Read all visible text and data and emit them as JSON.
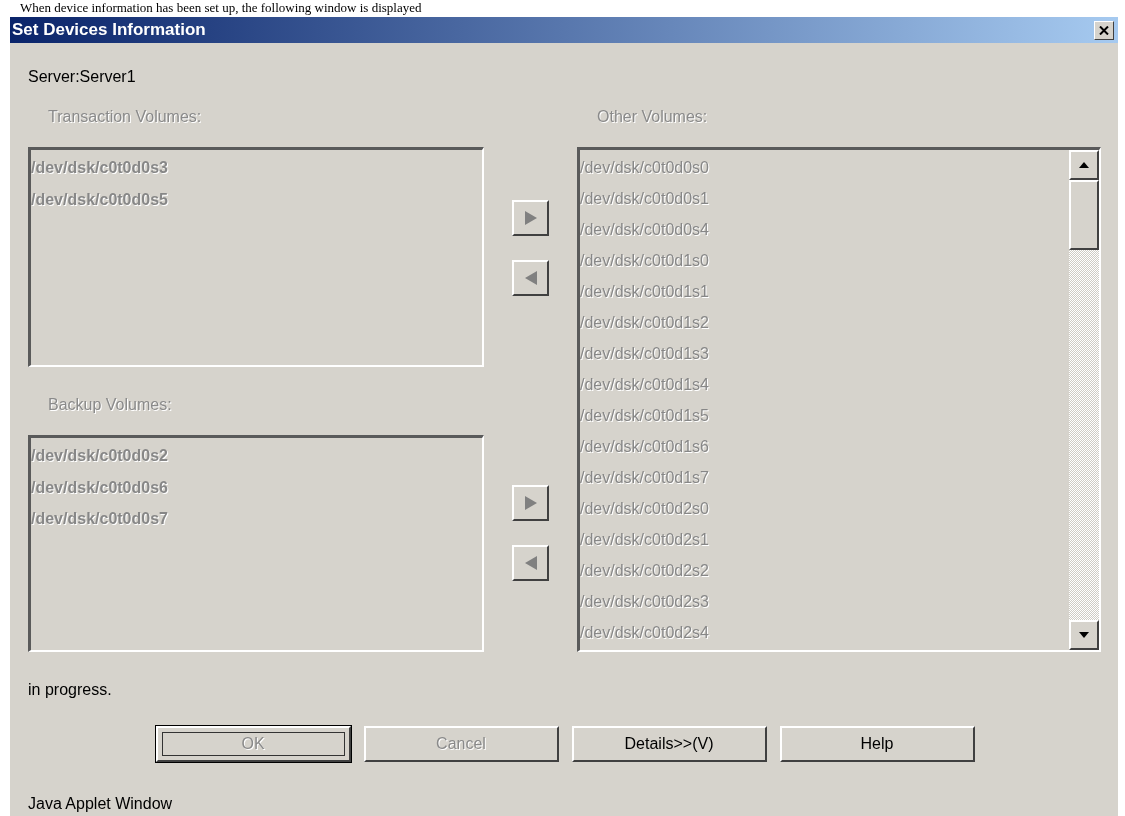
{
  "caption": "When device information has been set up, the following window is displayed",
  "window": {
    "title": "Set Devices Information"
  },
  "server_label": "Server:Server1",
  "transaction_volumes": {
    "label": "Transaction Volumes:",
    "disabled": true,
    "items": [
      "/dev/dsk/c0t0d0s3",
      "/dev/dsk/c0t0d0s5"
    ]
  },
  "transaction_move_buttons": [
    {
      "kind": "right",
      "disabled": true
    },
    {
      "kind": "left",
      "disabled": true
    }
  ],
  "backup_volumes": {
    "label": "Backup Volumes:",
    "disabled": true,
    "items": [
      "/dev/dsk/c0t0d0s2",
      "/dev/dsk/c0t0d0s6",
      "/dev/dsk/c0t0d0s7"
    ]
  },
  "backup_move_buttons": [
    {
      "kind": "right",
      "disabled": true
    },
    {
      "kind": "left",
      "disabled": true
    }
  ],
  "other_volumes": {
    "label": "Other Volumes:",
    "disabled": true,
    "items": [
      "/dev/dsk/c0t0d0s0",
      "/dev/dsk/c0t0d0s1",
      "/dev/dsk/c0t0d0s4",
      "/dev/dsk/c0t0d1s0",
      "/dev/dsk/c0t0d1s1",
      "/dev/dsk/c0t0d1s2",
      "/dev/dsk/c0t0d1s3",
      "/dev/dsk/c0t0d1s4",
      "/dev/dsk/c0t0d1s5",
      "/dev/dsk/c0t0d1s6",
      "/dev/dsk/c0t0d1s7",
      "/dev/dsk/c0t0d2s0",
      "/dev/dsk/c0t0d2s1",
      "/dev/dsk/c0t0d2s2",
      "/dev/dsk/c0t0d2s3",
      "/dev/dsk/c0t0d2s4"
    ]
  },
  "status_text": "in progress.",
  "buttons": [
    {
      "label": "OK",
      "disabled": true,
      "focused": true
    },
    {
      "label": "Cancel",
      "disabled": true,
      "focused": false
    },
    {
      "label": "Details>>(V)",
      "disabled": false,
      "focused": false
    },
    {
      "label": "Help",
      "disabled": false,
      "focused": false
    }
  ],
  "footer": "Java Applet Window"
}
